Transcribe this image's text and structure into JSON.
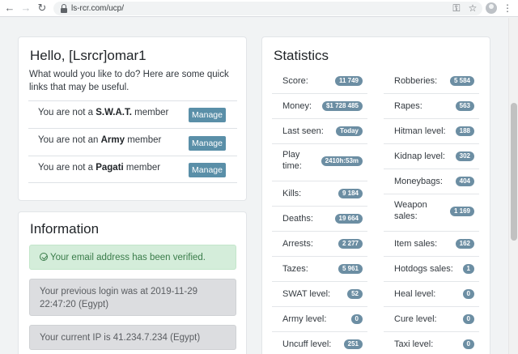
{
  "browser": {
    "url": "ls-rcr.com/ucp/"
  },
  "hello": {
    "title": "Hello, [Lsrcr]omar1",
    "lead": "What would you like to do? Here are some quick links that may be useful.",
    "rows": [
      {
        "prefix": "You are not a ",
        "group": "S.W.A.T.",
        "suffix": " member",
        "button": "Manage"
      },
      {
        "prefix": "You are not an ",
        "group": "Army",
        "suffix": " member",
        "button": "Manage"
      },
      {
        "prefix": "You are not a ",
        "group": "Pagati",
        "suffix": " member",
        "button": "Manage"
      }
    ]
  },
  "information": {
    "title": "Information",
    "verified": "Your email address has been verified.",
    "login": "Your previous login was at 2019-11-29 22:47:20 (Egypt)",
    "ip": "Your current IP is 41.234.7.234 (Egypt)"
  },
  "statistics": {
    "title": "Statistics",
    "left": [
      {
        "label": "Score:",
        "value": "11 749"
      },
      {
        "label": "Money:",
        "value": "$1 728 485"
      },
      {
        "label": "Last seen:",
        "value": "Today"
      },
      {
        "label": "Play time:",
        "value": "2410h:53m"
      },
      {
        "label": "Kills:",
        "value": "9 184"
      },
      {
        "label": "Deaths:",
        "value": "19 664"
      },
      {
        "label": "Arrests:",
        "value": "2 277"
      },
      {
        "label": "Tazes:",
        "value": "5 961"
      },
      {
        "label": "SWAT level:",
        "value": "52"
      },
      {
        "label": "Army level:",
        "value": "0"
      },
      {
        "label": "Uncuff level:",
        "value": "251"
      }
    ],
    "right": [
      {
        "label": "Robberies:",
        "value": "5 584"
      },
      {
        "label": "Rapes:",
        "value": "563"
      },
      {
        "label": "Hitman level:",
        "value": "188"
      },
      {
        "label": "Kidnap level:",
        "value": "302"
      },
      {
        "label": "Moneybags:",
        "value": "404"
      },
      {
        "label": "Weapon sales:",
        "value": "1 169"
      },
      {
        "label": "Item sales:",
        "value": "162"
      },
      {
        "label": "Hotdogs sales:",
        "value": "1"
      },
      {
        "label": "Heal level:",
        "value": "0"
      },
      {
        "label": "Cure level:",
        "value": "0"
      },
      {
        "label": "Taxi level:",
        "value": "0"
      }
    ]
  }
}
